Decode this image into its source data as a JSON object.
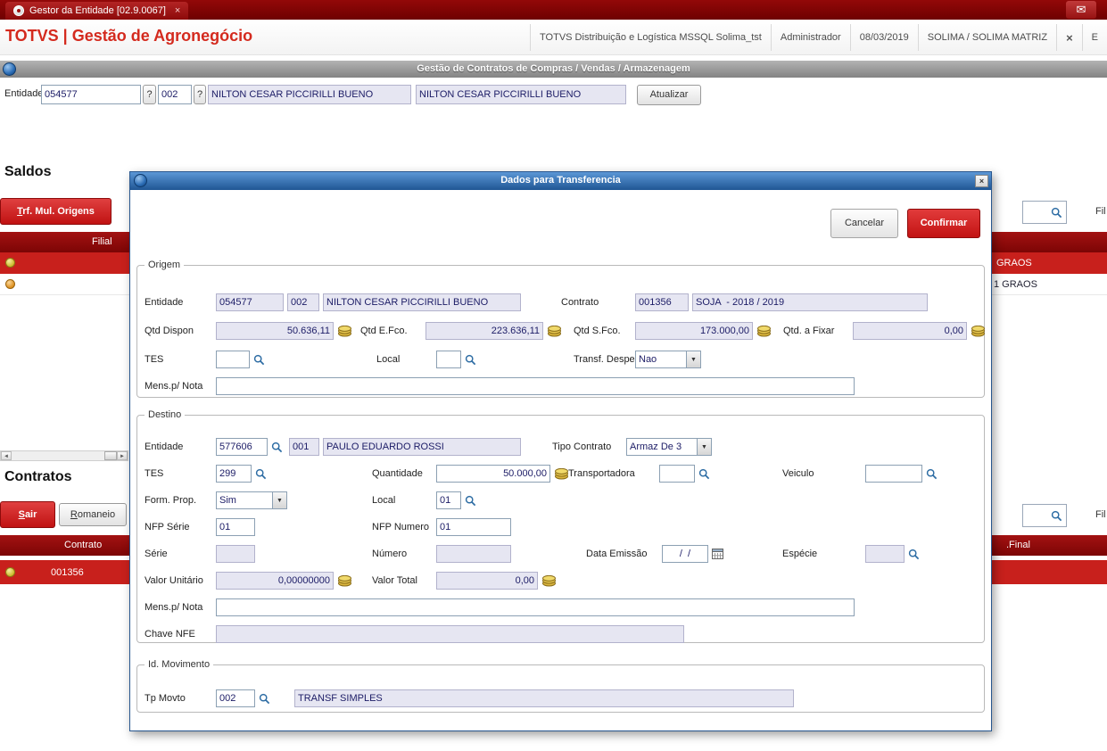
{
  "icons": {
    "close": "×",
    "dropdown": "▼",
    "mail": "✉",
    "help": "?",
    "left_arrow": "◄",
    "right_arrow": "►"
  },
  "topbar": {
    "tab_title": "Gestor da Entidade [02.9.0067]"
  },
  "header": {
    "app_title": "TOTVS | Gestão de Agronegócio",
    "env": "TOTVS Distribuição e Logística MSSQL Solima_tst",
    "user": "Administrador",
    "date": "08/03/2019",
    "company": "SOLIMA / SOLIMA MATRIZ",
    "partial": "E"
  },
  "banner": {
    "title": "Gestão de Contratos de Compras / Vendas / Armazenagem"
  },
  "entity_bar": {
    "label": "Entidade",
    "code": "054577",
    "store": "002",
    "name": "NILTON CESAR PICCIRILLI BUENO",
    "name2": "NILTON CESAR PICCIRILLI BUENO",
    "update": "Atualizar"
  },
  "saldos": {
    "heading": "Saldos",
    "trf_button": "Trf. Mul. Origens",
    "filter_suffix": "Fil",
    "columns": {
      "filial": "Filial"
    },
    "rows": [
      {
        "right": "GRAOS"
      },
      {
        "right": "1 GRAOS"
      }
    ]
  },
  "contratos": {
    "heading": "Contratos",
    "sair_button": "Sair",
    "romaneio_button": "Romaneio",
    "filter_suffix": "Fil",
    "columns": {
      "contrato": "Contrato",
      "final": ".Final"
    },
    "rows": [
      {
        "contrato": "001356"
      }
    ]
  },
  "modal": {
    "title": "Dados para Transferencia",
    "cancel_button": "Cancelar",
    "confirm_button": "Confirmar",
    "origem": {
      "legend": "Origem",
      "labels": {
        "entidade": "Entidade",
        "contrato": "Contrato",
        "qtd_dispon": "Qtd Dispon",
        "qtd_efco": "Qtd E.Fco.",
        "qtd_sfco": "Qtd S.Fco.",
        "qtd_fixar": "Qtd. a Fixar",
        "tes": "TES",
        "local": "Local",
        "transf_despesa": "Transf. Despesa",
        "mens": "Mens.p/ Nota"
      },
      "values": {
        "entidade": "054577",
        "loja": "002",
        "nome": "NILTON CESAR PICCIRILLI BUENO",
        "contrato": "001356",
        "contrato_desc": "SOJA  - 2018 / 2019",
        "qtd_dispon": "50.636,11",
        "qtd_efco": "223.636,11",
        "qtd_sfco": "173.000,00",
        "qtd_fixar": "0,00",
        "tes": "",
        "local": "",
        "transf_despesa": "Nao",
        "mens": ""
      }
    },
    "destino": {
      "legend": "Destino",
      "labels": {
        "entidade": "Entidade",
        "tipo_contrato": "Tipo Contrato",
        "tes": "TES",
        "quantidade": "Quantidade",
        "transportadora": "Transportadora",
        "veiculo": "Veiculo",
        "form_prop": "Form. Prop.",
        "local": "Local",
        "nfp_serie": "NFP Série",
        "nfp_numero": "NFP Numero",
        "serie": "Série",
        "numero": "Número",
        "data_emissao": "Data Emissão",
        "especie": "Espécie",
        "valor_unitario": "Valor Unitário",
        "valor_total": "Valor Total",
        "mens": "Mens.p/ Nota",
        "chave_nfe": "Chave NFE"
      },
      "values": {
        "entidade": "577606",
        "loja": "001",
        "nome": "PAULO EDUARDO ROSSI",
        "tipo_contrato": "Armaz De 3",
        "tes": "299",
        "quantidade": "50.000,00",
        "transportadora": "",
        "veiculo": "",
        "form_prop": "Sim",
        "local": "01",
        "nfp_serie": "01",
        "nfp_numero": "01",
        "serie": "",
        "numero": "",
        "data_emissao": "/  /",
        "especie": "",
        "valor_unitario": "0,00000000",
        "valor_total": "0,00",
        "mens": "",
        "chave_nfe": ""
      }
    },
    "movimento": {
      "legend": "Id. Movimento",
      "labels": {
        "tp_movto": "Tp Movto"
      },
      "values": {
        "tp_movto": "002",
        "descricao": "TRANSF SIMPLES"
      }
    }
  }
}
